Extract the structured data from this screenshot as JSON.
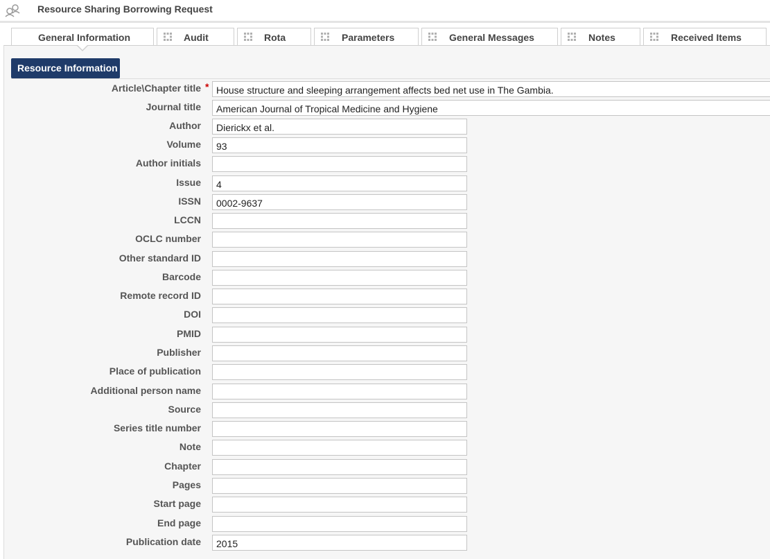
{
  "header": {
    "title": "Resource Sharing Borrowing Request",
    "icon": "resource-sharing-icon"
  },
  "tabs": [
    {
      "label": "General Information",
      "active": true,
      "has_grip": false
    },
    {
      "label": "Audit",
      "active": false,
      "has_grip": true
    },
    {
      "label": "Rota",
      "active": false,
      "has_grip": true
    },
    {
      "label": "Parameters",
      "active": false,
      "has_grip": true
    },
    {
      "label": "General Messages",
      "active": false,
      "has_grip": true
    },
    {
      "label": "Notes",
      "active": false,
      "has_grip": true
    },
    {
      "label": "Received Items",
      "active": false,
      "has_grip": true
    }
  ],
  "section": {
    "title": "Resource Information"
  },
  "fields": [
    {
      "label": "Article\\Chapter title",
      "value": "House structure and sleeping arrangement affects bed net use in The Gambia.",
      "required": true,
      "wide": true
    },
    {
      "label": "Journal title",
      "value": "American Journal of Tropical Medicine and Hygiene",
      "required": false,
      "wide": true
    },
    {
      "label": "Author",
      "value": "Dierickx et al.",
      "required": false,
      "wide": false
    },
    {
      "label": "Volume",
      "value": "93",
      "required": false,
      "wide": false
    },
    {
      "label": "Author initials",
      "value": "",
      "required": false,
      "wide": false
    },
    {
      "label": "Issue",
      "value": "4",
      "required": false,
      "wide": false
    },
    {
      "label": "ISSN",
      "value": "0002-9637",
      "required": false,
      "wide": false
    },
    {
      "label": "LCCN",
      "value": "",
      "required": false,
      "wide": false
    },
    {
      "label": "OCLC number",
      "value": "",
      "required": false,
      "wide": false
    },
    {
      "label": "Other standard ID",
      "value": "",
      "required": false,
      "wide": false
    },
    {
      "label": "Barcode",
      "value": "",
      "required": false,
      "wide": false
    },
    {
      "label": "Remote record ID",
      "value": "",
      "required": false,
      "wide": false
    },
    {
      "label": "DOI",
      "value": "",
      "required": false,
      "wide": false
    },
    {
      "label": "PMID",
      "value": "",
      "required": false,
      "wide": false
    },
    {
      "label": "Publisher",
      "value": "",
      "required": false,
      "wide": false
    },
    {
      "label": "Place of publication",
      "value": "",
      "required": false,
      "wide": false
    },
    {
      "label": "Additional person name",
      "value": "",
      "required": false,
      "wide": false
    },
    {
      "label": "Source",
      "value": "",
      "required": false,
      "wide": false
    },
    {
      "label": "Series title number",
      "value": "",
      "required": false,
      "wide": false
    },
    {
      "label": "Note",
      "value": "",
      "required": false,
      "wide": false
    },
    {
      "label": "Chapter",
      "value": "",
      "required": false,
      "wide": false
    },
    {
      "label": "Pages",
      "value": "",
      "required": false,
      "wide": false
    },
    {
      "label": "Start page",
      "value": "",
      "required": false,
      "wide": false
    },
    {
      "label": "End page",
      "value": "",
      "required": false,
      "wide": false
    },
    {
      "label": "Publication date",
      "value": "2015",
      "required": false,
      "wide": false
    }
  ],
  "colors": {
    "section_header_bg": "#1f3b69",
    "required_marker": "#cc0000"
  }
}
